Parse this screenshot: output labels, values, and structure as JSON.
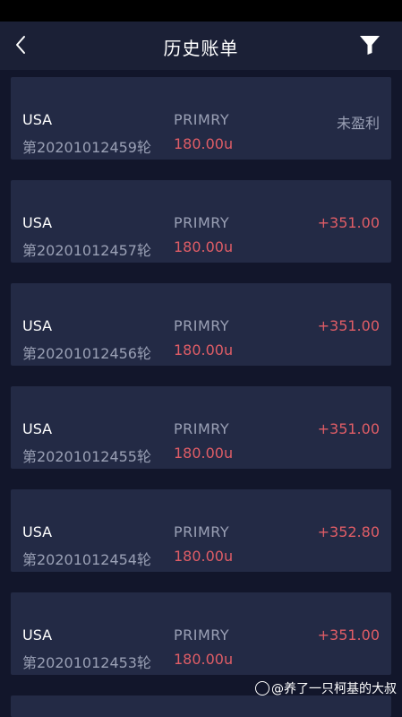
{
  "header": {
    "title": "历史账单"
  },
  "icons": {
    "back": "chevron-left-icon",
    "filter": "filter-funnel-icon"
  },
  "colors": {
    "background": "#12162b",
    "navbar": "#1b2036",
    "card": "#232a45",
    "profit": "#e05d66",
    "muted": "#9aa0b5"
  },
  "records": [
    {
      "symbol": "USA",
      "round": "第20201012459轮",
      "plan": "PRIMRY",
      "amount": "180.00u",
      "result": "未盈利",
      "status": "none"
    },
    {
      "symbol": "USA",
      "round": "第20201012457轮",
      "plan": "PRIMRY",
      "amount": "180.00u",
      "result": "+351.00",
      "status": "profit"
    },
    {
      "symbol": "USA",
      "round": "第20201012456轮",
      "plan": "PRIMRY",
      "amount": "180.00u",
      "result": "+351.00",
      "status": "profit"
    },
    {
      "symbol": "USA",
      "round": "第20201012455轮",
      "plan": "PRIMRY",
      "amount": "180.00u",
      "result": "+351.00",
      "status": "profit"
    },
    {
      "symbol": "USA",
      "round": "第20201012454轮",
      "plan": "PRIMRY",
      "amount": "180.00u",
      "result": "+352.80",
      "status": "profit"
    },
    {
      "symbol": "USA",
      "round": "第20201012453轮",
      "plan": "PRIMRY",
      "amount": "180.00u",
      "result": "+351.00",
      "status": "profit"
    }
  ],
  "watermark": {
    "text": "@养了一只柯基的大叔"
  }
}
